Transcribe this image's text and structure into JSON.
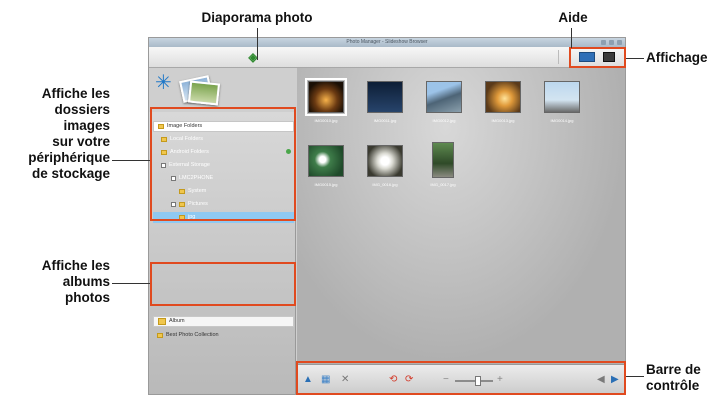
{
  "callouts": {
    "slideshow": "Diaporama photo",
    "help": "Aide",
    "display": "Affichage",
    "folders_line1": "Affiche les",
    "folders_line2": "dossiers",
    "folders_line3": "images",
    "folders_line4": "sur votre",
    "folders_line5": "périphérique",
    "folders_line6": "de stockage",
    "albums_line1": "Affiche les",
    "albums_line2": "albums",
    "albums_line3": "photos",
    "control_line1": "Barre de",
    "control_line2": "contrôle"
  },
  "app": {
    "title": "Photo Manager - Slideshow Browser"
  },
  "sidebar": {
    "folders": [
      {
        "label": "Image Folders"
      },
      {
        "label": "Local Folders"
      },
      {
        "label": "Android Folders"
      },
      {
        "label": "External Storage"
      },
      {
        "label": "LMC2PHONE"
      },
      {
        "label": "System"
      },
      {
        "label": "Pictures"
      },
      {
        "label": "jpg"
      }
    ],
    "albums": [
      {
        "label": "Album"
      },
      {
        "label": "Best Photo Collection"
      }
    ]
  },
  "thumbnails": [
    {
      "name": "thumb-night-city-icon",
      "caption": "IMG0010.jpg"
    },
    {
      "name": "thumb-tower-icon",
      "caption": "IMG0011.jpg"
    },
    {
      "name": "thumb-mountain-icon",
      "caption": "IMG0012.jpg"
    },
    {
      "name": "thumb-sunset-icon",
      "caption": "IMG0013.jpg"
    },
    {
      "name": "thumb-satellite-dish-icon",
      "caption": "IMG0014.jpg"
    },
    {
      "name": "thumb-flowers-icon",
      "caption": "IMG0015.jpg"
    },
    {
      "name": "thumb-white-flower-icon",
      "caption": "IMG_0016.jpg"
    },
    {
      "name": "thumb-tree-icon",
      "caption": "IMG_0017.jpg"
    }
  ],
  "colors": {
    "highlight": "#e04a1f",
    "selection": "#8fc9f2",
    "accent_blue": "#2f6fb7"
  }
}
